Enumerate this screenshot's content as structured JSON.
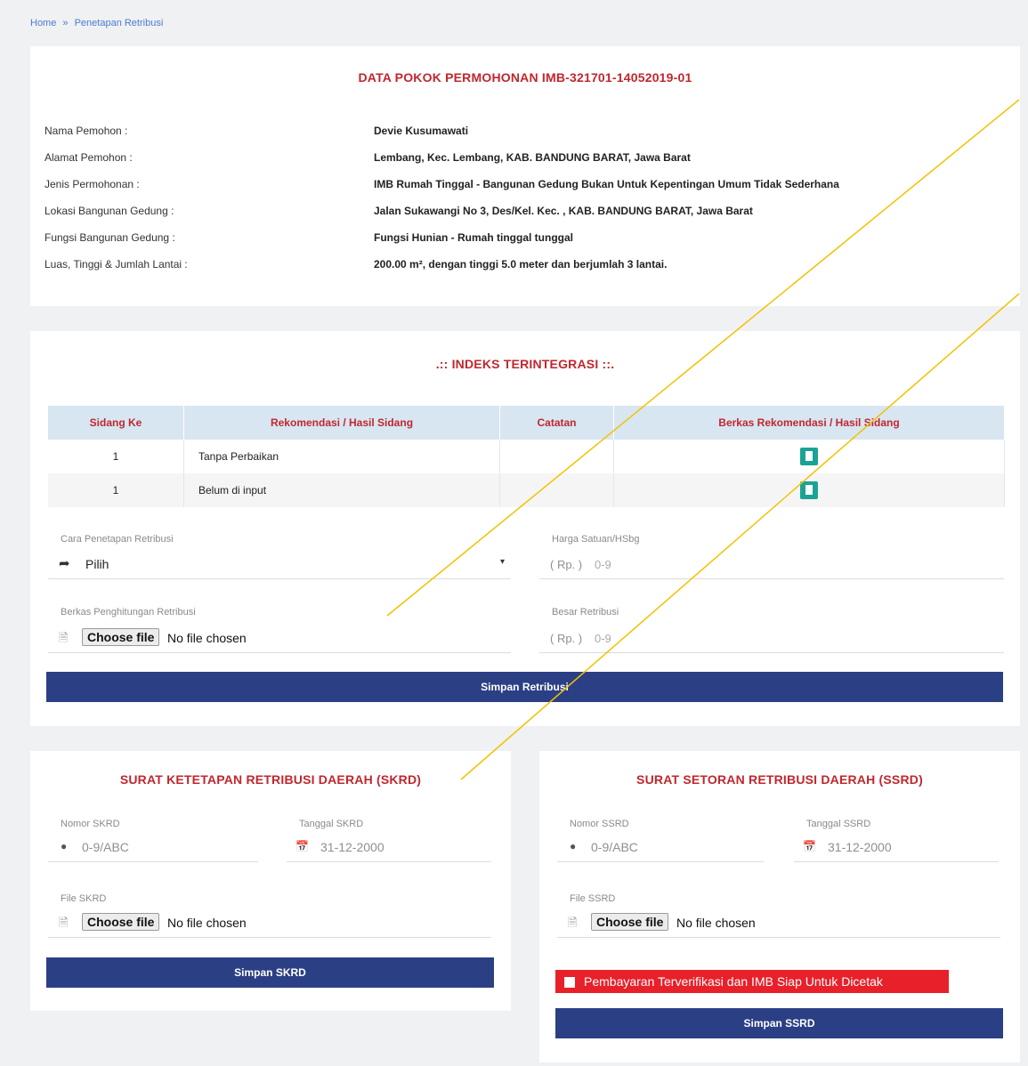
{
  "breadcrumb": {
    "home": "Home",
    "sep": "»",
    "current": "Penetapan Retribusi"
  },
  "data_pokok": {
    "title": "DATA POKOK PERMOHONAN IMB-321701-14052019-01",
    "rows": [
      {
        "label": "Nama Pemohon :",
        "value": "Devie Kusumawati"
      },
      {
        "label": "Alamat Pemohon :",
        "value": "Lembang, Kec. Lembang, KAB. BANDUNG BARAT, Jawa Barat"
      },
      {
        "label": "Jenis Permohonan :",
        "value": "IMB Rumah Tinggal - Bangunan Gedung Bukan Untuk Kepentingan Umum Tidak Sederhana"
      },
      {
        "label": "Lokasi Bangunan Gedung :",
        "value": "Jalan Sukawangi No 3, Des/Kel. Kec. , KAB. BANDUNG BARAT, Jawa Barat"
      },
      {
        "label": "Fungsi Bangunan Gedung :",
        "value": "Fungsi Hunian - Rumah tinggal tunggal"
      },
      {
        "label": "Luas, Tinggi & Jumlah Lantai :",
        "value": "200.00 m², dengan tinggi 5.0 meter dan berjumlah 3 lantai."
      }
    ]
  },
  "indeks": {
    "title": ".:: INDEKS TERINTEGRASI ::.",
    "headers": [
      "Sidang Ke",
      "Rekomendasi / Hasil Sidang",
      "Catatan",
      "Berkas Rekomendasi / Hasil Sidang"
    ],
    "rows": [
      {
        "sidang": "1",
        "hasil": "Tanpa Perbaikan",
        "catatan": ""
      },
      {
        "sidang": "1",
        "hasil": "Belum di input",
        "catatan": ""
      }
    ],
    "cara_label": "Cara Penetapan Retribusi",
    "cara_value": "Pilih",
    "harga_label": "Harga Satuan/HSbg",
    "harga_prefix": "( Rp. )",
    "harga_placeholder": "0-9",
    "berkas_label": "Berkas Penghitungan Retribusi",
    "choose_file": "Choose file",
    "no_file": "No file chosen",
    "besar_label": "Besar Retribusi",
    "besar_prefix": "( Rp. )",
    "besar_placeholder": "0-9",
    "save_button": "Simpan Retribusi"
  },
  "skrd": {
    "title": "SURAT KETETAPAN RETRIBUSI DAERAH (SKRD)",
    "nomor_label": "Nomor SKRD",
    "nomor_placeholder": "0-9/ABC",
    "tanggal_label": "Tanggal SKRD",
    "tanggal_placeholder": "31-12-2000",
    "file_label": "File SKRD",
    "choose_file": "Choose file",
    "no_file": "No file chosen",
    "save_button": "Simpan SKRD"
  },
  "ssrd": {
    "title": "SURAT SETORAN RETRIBUSI DAERAH (SSRD)",
    "nomor_label": "Nomor SSRD",
    "nomor_placeholder": "0-9/ABC",
    "tanggal_label": "Tanggal SSRD",
    "tanggal_placeholder": "31-12-2000",
    "file_label": "File SSRD",
    "choose_file": "Choose file",
    "no_file": "No file chosen",
    "verify_label": "Pembayaran Terverifikasi dan IMB Siap Untuk Dicetak",
    "save_button": "Simpan SSRD"
  },
  "colors": {
    "accent_red": "#c0272d",
    "button_blue": "#2b3f85",
    "icon_teal": "#1aa394",
    "verify_red": "#e8202a",
    "leader_line": "#f2c200"
  }
}
